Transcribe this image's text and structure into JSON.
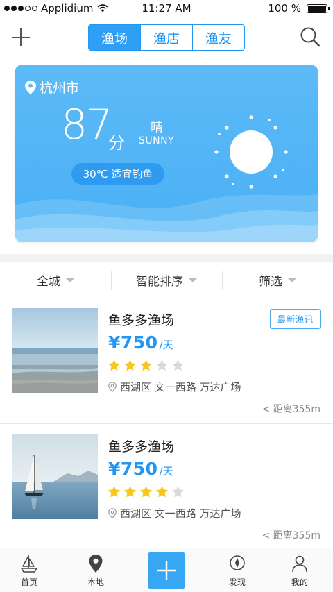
{
  "status_bar": {
    "carrier": "Applidium",
    "time": "11:27 AM",
    "battery": "100 %",
    "battery_level": 1.0,
    "signal_bars_filled": 3
  },
  "nav": {
    "tabs": [
      {
        "label": "渔场",
        "active": true
      },
      {
        "label": "渔店",
        "active": false
      },
      {
        "label": "渔友",
        "active": false
      }
    ]
  },
  "weather": {
    "city": "杭州市",
    "score": "87",
    "score_unit": "分",
    "condition_cn": "晴",
    "condition_en": "SUNNY",
    "tip": "30℃ 适宜钓鱼",
    "card_color": "#5cbaf7"
  },
  "filters": [
    {
      "label": "全城"
    },
    {
      "label": "智能排序"
    },
    {
      "label": "筛选"
    }
  ],
  "listings": [
    {
      "title": "鱼多多渔场",
      "tag": "最新渔讯",
      "price": "¥750",
      "price_unit": "/天",
      "rating": 3,
      "rating_max": 5,
      "address": "西湖区 文一西路 万达广场",
      "distance": "< 距离355m",
      "image": "beach-photo"
    },
    {
      "title": "鱼多多渔场",
      "tag": "",
      "price": "¥750",
      "price_unit": "/天",
      "rating": 4,
      "rating_max": 5,
      "address": "西湖区 文一西路 万达广场",
      "distance": "< 距离355m",
      "image": "sailboat-photo"
    }
  ],
  "tab_bar": {
    "home": "首页",
    "local": "本地",
    "discover": "发现",
    "mine": "我的",
    "accent": "#36a7f3"
  },
  "colors": {
    "accent": "#2196f3",
    "star_on": "#f7c61c",
    "star_off": "#d9d9d9"
  }
}
